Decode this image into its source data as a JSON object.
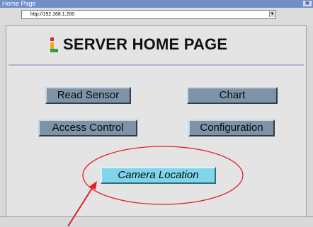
{
  "window": {
    "title": "Home Page",
    "address_url": "http://192.168.1.200"
  },
  "page": {
    "heading": "SERVER HOME PAGE",
    "buttons": [
      {
        "label": "Read Sensor"
      },
      {
        "label": "Chart"
      },
      {
        "label": "Access Control"
      },
      {
        "label": "Configuration"
      }
    ],
    "highlight_button": {
      "label": "Camera Location"
    }
  },
  "colors": {
    "button_gray": "#7d93a8",
    "button_highlight": "#7fd5ea",
    "annotation_red": "#e3202a",
    "titlebar": "#6f8fc9"
  },
  "icons": {
    "logo": "server-logo-icon",
    "annotation": "red-arrow-ellipse"
  }
}
